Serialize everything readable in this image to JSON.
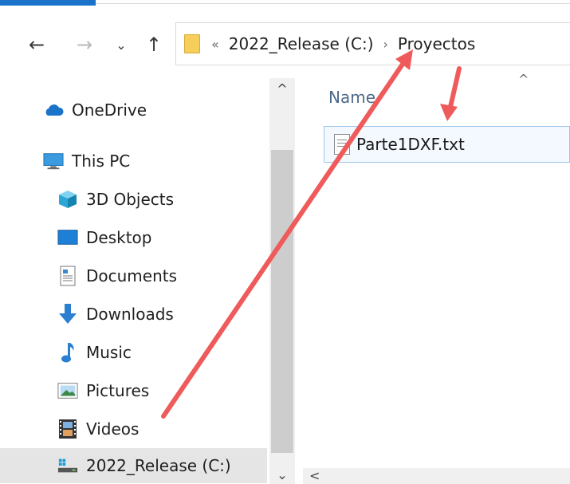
{
  "navigation": {
    "back_icon": "←",
    "forward_icon": "→",
    "recent_icon": "⌄",
    "up_icon": "↑"
  },
  "address_bar": {
    "overflow": "«",
    "segments": [
      "2022_Release (C:)",
      "Proyectos"
    ],
    "separator": "›"
  },
  "sidebar": {
    "items": [
      {
        "label": "OneDrive",
        "icon": "cloud-icon"
      },
      {
        "label": "This PC",
        "icon": "computer-icon"
      },
      {
        "label": "3D Objects",
        "icon": "cube-icon"
      },
      {
        "label": "Desktop",
        "icon": "desktop-icon"
      },
      {
        "label": "Documents",
        "icon": "document-icon"
      },
      {
        "label": "Downloads",
        "icon": "download-arrow-icon"
      },
      {
        "label": "Music",
        "icon": "music-note-icon"
      },
      {
        "label": "Pictures",
        "icon": "picture-icon"
      },
      {
        "label": "Videos",
        "icon": "film-icon"
      },
      {
        "label": "2022_Release (C:)",
        "icon": "drive-icon",
        "selected": true
      }
    ]
  },
  "content": {
    "column_name": "Name",
    "sort_indicator": "^",
    "files": [
      {
        "name": "Parte1DXF.txt",
        "icon": "text-file-icon"
      }
    ]
  },
  "scrollbars": {
    "up": "^",
    "down": "⌄",
    "left": "<"
  },
  "colors": {
    "annotation_arrow": "#ef5a5a",
    "accent": "#1a73c8",
    "selection_border": "#9cc4ec"
  }
}
